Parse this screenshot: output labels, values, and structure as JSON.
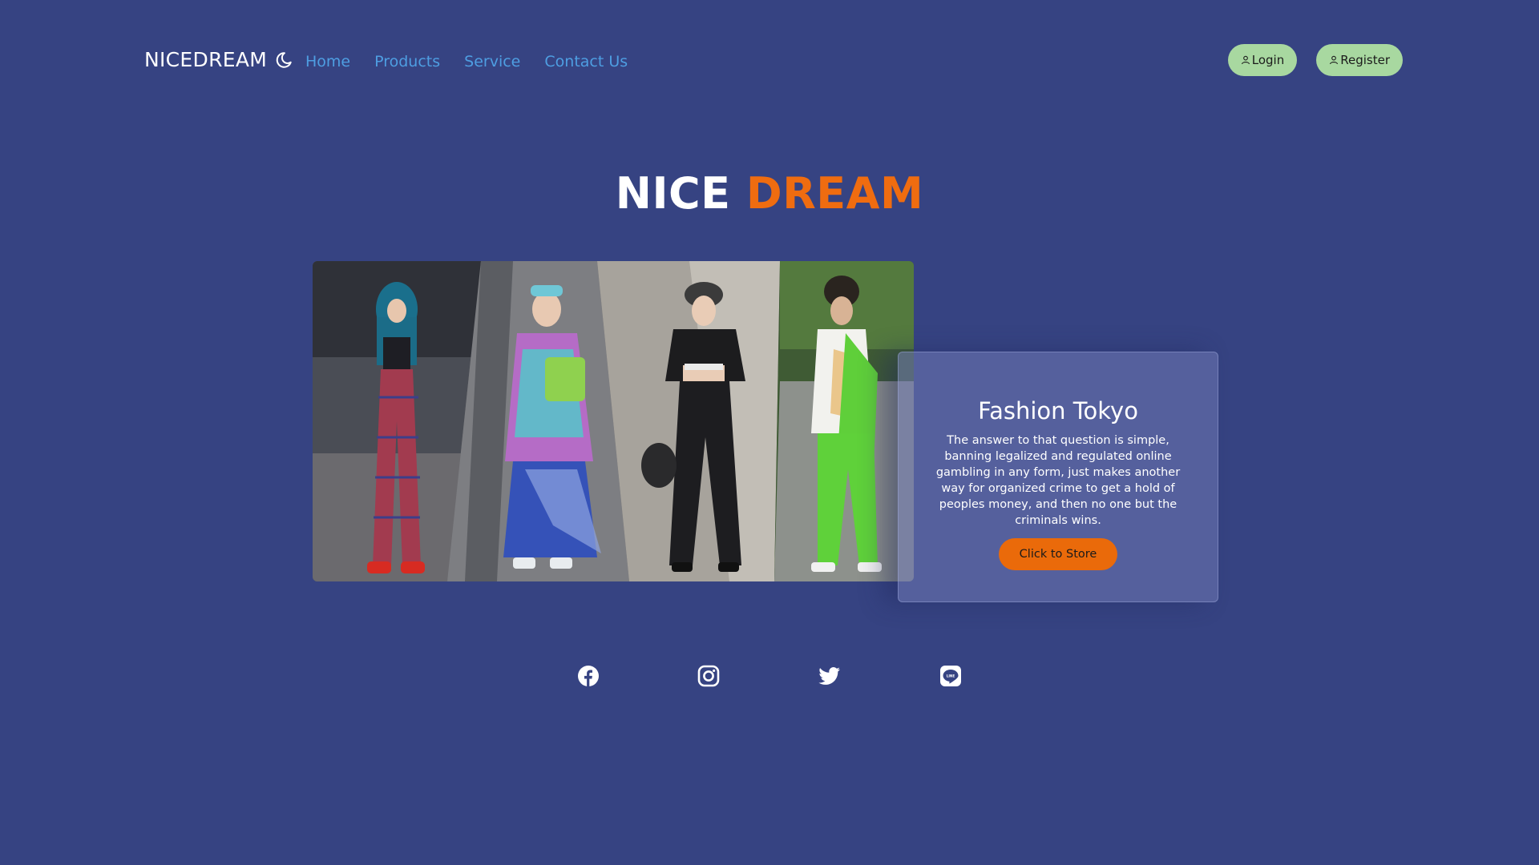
{
  "brand": {
    "name": "NICEDREAM",
    "icon": "moon-icon"
  },
  "nav": {
    "items": [
      {
        "label": "Home"
      },
      {
        "label": "Products"
      },
      {
        "label": "Service"
      },
      {
        "label": "Contact Us"
      }
    ]
  },
  "auth": {
    "login_label": "Login",
    "register_label": "Register",
    "icon": "user-icon"
  },
  "hero": {
    "title_part1": "NICE",
    "title_part2": "DREAM"
  },
  "card": {
    "title": "Fashion Tokyo",
    "text": "The answer to that question is simple, banning legalized and regulated online gambling in any form, just makes another way for organized crime to get a hold of peoples money, and then no one but the criminals wins.",
    "button_label": "Click to Store"
  },
  "social": {
    "icons": [
      "facebook-icon",
      "instagram-icon",
      "twitter-icon",
      "line-icon"
    ]
  },
  "colors": {
    "background": "#364382",
    "accent": "#ef6c10",
    "nav_link": "#4e9ee2",
    "auth_button": "#a8d8a0",
    "store_button": "#ea6a0a"
  }
}
